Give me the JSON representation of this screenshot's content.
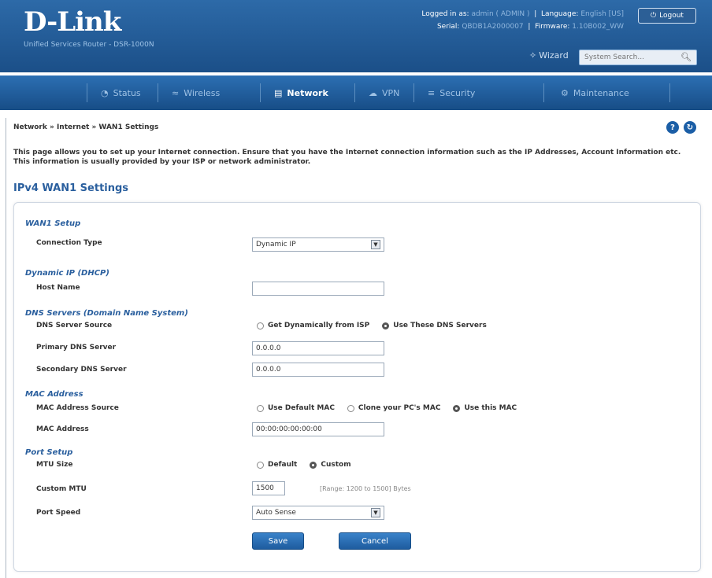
{
  "header": {
    "logo": "D-Link",
    "subtitle": "Unified Services Router - DSR-1000N",
    "logged_in_label": "Logged in as:",
    "user": "admin ( ADMIN )",
    "language_label": "Language:",
    "language": "English [US]",
    "serial_label": "Serial:",
    "serial": "QBDB1A2000007",
    "firmware_label": "Firmware:",
    "firmware": "1.10B002_WW",
    "logout": "Logout",
    "wizard": "Wizard",
    "search_placeholder": "System Search..."
  },
  "nav": {
    "items": [
      {
        "label": "Status",
        "icon": "dashboard-icon"
      },
      {
        "label": "Wireless",
        "icon": "wifi-icon"
      },
      {
        "label": "Network",
        "icon": "network-icon"
      },
      {
        "label": "VPN",
        "icon": "cloud-icon"
      },
      {
        "label": "Security",
        "icon": "lock-icon"
      },
      {
        "label": "Maintenance",
        "icon": "gear-icon"
      }
    ],
    "active": "Network"
  },
  "breadcrumb": "Network » Internet » WAN1 Settings",
  "intro": "This page allows you to set up your Internet connection. Ensure that you have the Internet connection information such as the IP Addresses, Account Information etc. This information is usually provided by your ISP or network administrator.",
  "section_title": "IPv4 WAN1 Settings",
  "form": {
    "wan_setup_title": "WAN1 Setup",
    "connection_type_label": "Connection Type",
    "connection_type_value": "Dynamic IP",
    "dhcp_title": "Dynamic IP (DHCP)",
    "host_name_label": "Host Name",
    "host_name_value": "",
    "dns_title": "DNS Servers (Domain Name System)",
    "dns_source_label": "DNS Server Source",
    "dns_opt1": "Get Dynamically from ISP",
    "dns_opt2": "Use These DNS Servers",
    "primary_dns_label": "Primary DNS Server",
    "primary_dns_value": "0.0.0.0",
    "secondary_dns_label": "Secondary DNS Server",
    "secondary_dns_value": "0.0.0.0",
    "mac_title": "MAC Address",
    "mac_source_label": "MAC Address Source",
    "mac_opt1": "Use Default MAC",
    "mac_opt2": "Clone your PC's MAC",
    "mac_opt3": "Use this MAC",
    "mac_address_label": "MAC Address",
    "mac_address_value": "00:00:00:00:00:00",
    "port_title": "Port Setup",
    "mtu_size_label": "MTU Size",
    "mtu_opt1": "Default",
    "mtu_opt2": "Custom",
    "custom_mtu_label": "Custom MTU",
    "custom_mtu_value": "1500",
    "custom_mtu_hint": "[Range: 1200 to 1500] Bytes",
    "port_speed_label": "Port Speed",
    "port_speed_value": "Auto Sense",
    "save": "Save",
    "cancel": "Cancel"
  }
}
